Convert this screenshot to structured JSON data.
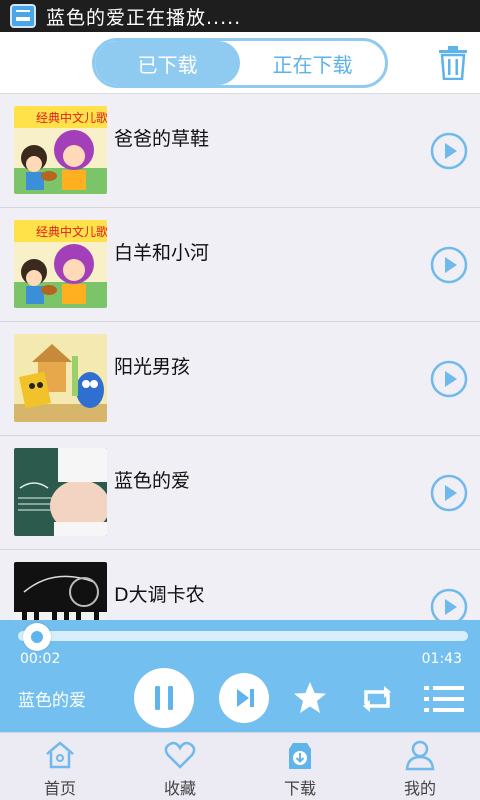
{
  "status_bar": {
    "text": "蓝色的爱正在播放....."
  },
  "header": {
    "tabs": [
      {
        "label": "已下载",
        "active": true
      },
      {
        "label": "正在下载",
        "active": false
      }
    ],
    "trash_icon": "trash-icon"
  },
  "songs": [
    {
      "title": "爸爸的草鞋",
      "thumb": "cartoon-girl-violin"
    },
    {
      "title": "白羊和小河",
      "thumb": "cartoon-girl-violin"
    },
    {
      "title": "阳光男孩",
      "thumb": "cartoon-toys"
    },
    {
      "title": "蓝色的爱",
      "thumb": "pregnant-belly-chalkboard"
    },
    {
      "title": "D大调卡农",
      "thumb": "piano-keys"
    }
  ],
  "player": {
    "current_time": "00:02",
    "total_time": "01:43",
    "progress": 0.02,
    "now_playing": "蓝色的爱",
    "controls": [
      "pause-icon",
      "next-icon",
      "star-icon",
      "repeat-icon",
      "playlist-icon"
    ]
  },
  "nav": [
    {
      "label": "首页",
      "icon": "home-icon"
    },
    {
      "label": "收藏",
      "icon": "heart-icon"
    },
    {
      "label": "下载",
      "icon": "download-icon",
      "active": true
    },
    {
      "label": "我的",
      "icon": "user-icon"
    }
  ],
  "colors": {
    "accent": "#73bff0",
    "accent_light": "#8fcbf1",
    "status_bg": "#1e1e1e",
    "nav_bg": "#eceaf2"
  }
}
